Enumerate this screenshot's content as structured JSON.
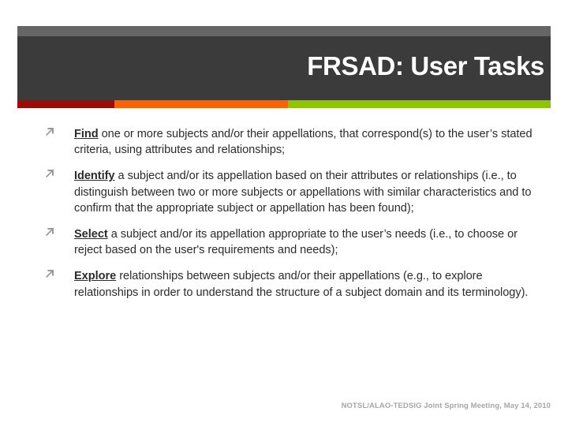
{
  "slide": {
    "title": "FRSAD: User Tasks",
    "colors": {
      "header_top_strip": "#666666",
      "header_body": "#3b3b3b",
      "stripe_red": "#9c0c06",
      "stripe_orange": "#f96302",
      "stripe_green": "#8ec400",
      "body_text": "#2b2b2b",
      "bullet_marker": "#9a9a9a",
      "footer_text": "#a6a6a6",
      "title_text": "#ffffff"
    },
    "bullet_marker_icon": "arrow-northeast-icon",
    "bullets": [
      {
        "lead": "Find",
        "rest": " one or more subjects and/or their appellations, that correspond(s) to the user’s stated criteria, using attributes and relationships;"
      },
      {
        "lead": "Identify",
        "rest": " a subject and/or its appellation based on their attributes or relationships (i.e., to distinguish between two or more subjects or appellations with similar characteristics and to confirm that the appropriate subject or appellation has been found);"
      },
      {
        "lead": "Select",
        "rest": " a subject and/or its appellation appropriate to the user’s needs (i.e., to choose or reject based on the user's requirements and needs);"
      },
      {
        "lead": "Explore",
        "rest": " relationships between subjects and/or their appellations (e.g., to explore relationships in order to understand the structure of a subject domain and its terminology)."
      }
    ],
    "footer": "NOTSL/ALAO-TEDSIG Joint Spring Meeting, May 14, 2010"
  }
}
